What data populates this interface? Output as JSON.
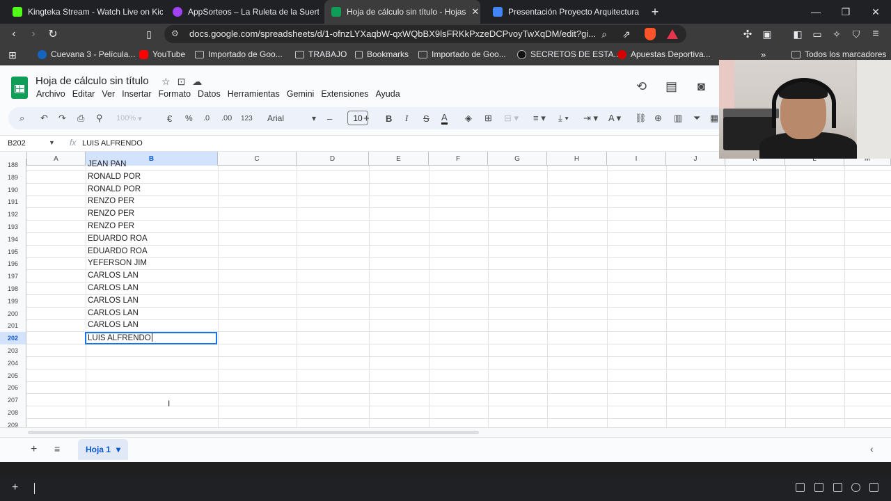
{
  "browser": {
    "tabs": [
      {
        "title": "Kingteka Stream - Watch Live on Kick",
        "favicon_color": "#53fc18"
      },
      {
        "title": "AppSorteos – La Ruleta de la Suerte",
        "favicon_color": "#a142f4"
      },
      {
        "title": "Hoja de cálculo sin título - Hojas",
        "favicon_color": "#0f9d58",
        "active": true
      },
      {
        "title": "Presentación Proyecto Arquitectura M",
        "favicon_color": "#4285f4"
      }
    ],
    "new_tab_label": "+",
    "url": "docs.google.com/spreadsheets/d/1-ofnzLYXaqbW-qxWQbBX9lsFRKkPxzeDCPvoyTwXqDM/edit?gi...",
    "bookmarks": [
      {
        "label": "Cuevana 3 - Película..."
      },
      {
        "label": "YouTube"
      },
      {
        "label": "Importado de Goo..."
      },
      {
        "label": "TRABAJO"
      },
      {
        "label": "Bookmarks"
      },
      {
        "label": "Importado de Goo..."
      },
      {
        "label": "SECRETOS DE ESTA..."
      },
      {
        "label": "Apuestas Deportiva..."
      }
    ],
    "bookmarks_overflow": "»",
    "all_bookmarks": "Todos los marcadores"
  },
  "sheets": {
    "doc_title": "Hoja de cálculo sin título",
    "menu": [
      "Archivo",
      "Editar",
      "Ver",
      "Insertar",
      "Formato",
      "Datos",
      "Herramientas",
      "Gemini",
      "Extensiones",
      "Ayuda"
    ],
    "toolbar": {
      "zoom": "100%",
      "currency": "€",
      "percent": "%",
      "dec_decrease": ".0",
      "dec_increase": ".00",
      "more_formats": "123",
      "font": "Arial",
      "font_size": "10",
      "minus": "–",
      "plus": "+",
      "bold": "B",
      "italic": "I"
    },
    "name_box": "B202",
    "fx": "fx",
    "formula": "LUIS ALFRENDO",
    "columns": [
      "A",
      "B",
      "C",
      "D",
      "E",
      "F",
      "G",
      "H",
      "I",
      "J",
      "K",
      "L",
      "M"
    ],
    "selected_column": "B",
    "rows": [
      {
        "num": "188",
        "b": "JEAN PAN"
      },
      {
        "num": "189",
        "b": "RONALD POR"
      },
      {
        "num": "190",
        "b": "RONALD POR"
      },
      {
        "num": "191",
        "b": "RENZO PER"
      },
      {
        "num": "192",
        "b": "RENZO PER"
      },
      {
        "num": "193",
        "b": "RENZO PER"
      },
      {
        "num": "194",
        "b": "EDUARDO ROA"
      },
      {
        "num": "195",
        "b": "EDUARDO ROA"
      },
      {
        "num": "196",
        "b": "YEFERSON JIM"
      },
      {
        "num": "197",
        "b": "CARLOS LAN"
      },
      {
        "num": "198",
        "b": "CARLOS LAN"
      },
      {
        "num": "199",
        "b": "CARLOS LAN"
      },
      {
        "num": "200",
        "b": "CARLOS LAN"
      },
      {
        "num": "201",
        "b": "CARLOS LAN"
      },
      {
        "num": "202",
        "b": ""
      },
      {
        "num": "203",
        "b": ""
      },
      {
        "num": "204",
        "b": ""
      },
      {
        "num": "205",
        "b": ""
      },
      {
        "num": "206",
        "b": ""
      },
      {
        "num": "207",
        "b": ""
      },
      {
        "num": "208",
        "b": ""
      },
      {
        "num": "209",
        "b": ""
      }
    ],
    "active_cell_value": "LUIS ALFRENDO",
    "selected_row": "202",
    "sheet_tab": "Hoja 1",
    "accent": "#1a73e8"
  }
}
